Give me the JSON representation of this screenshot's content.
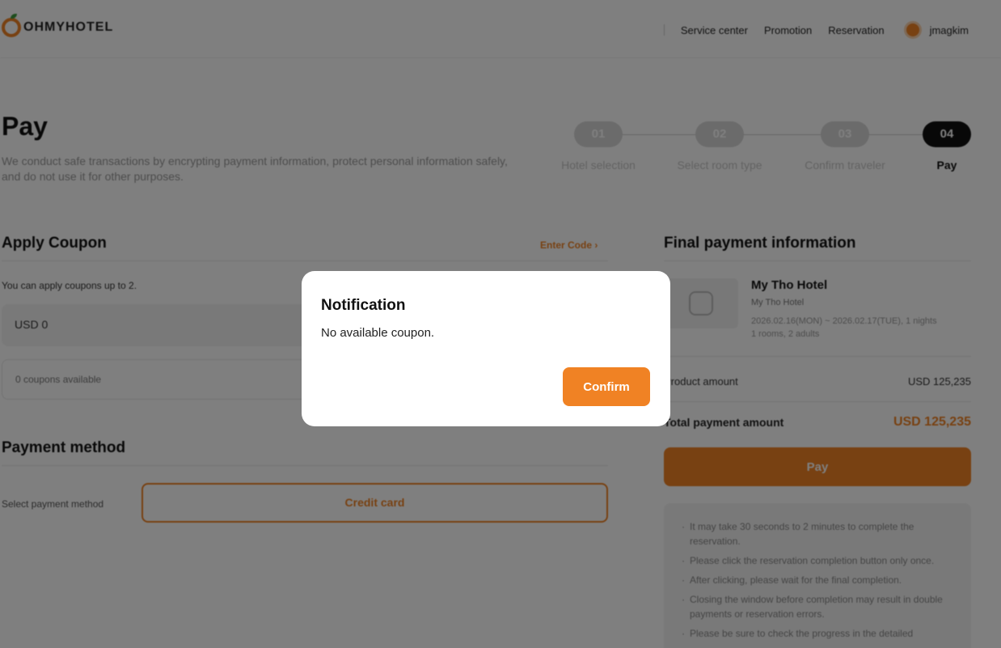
{
  "header": {
    "logo_text": "OHMYHOTEL",
    "nav": [
      "Service center",
      "Promotion",
      "Reservation"
    ],
    "username": "jmagkim"
  },
  "page": {
    "title": "Pay",
    "description": "We conduct safe transactions by encrypting payment information, protect personal information safely, and do not use it for other purposes."
  },
  "steps": [
    {
      "num": "01",
      "label": "Hotel selection",
      "active": false
    },
    {
      "num": "02",
      "label": "Select room type",
      "active": false
    },
    {
      "num": "03",
      "label": "Confirm traveler",
      "active": false
    },
    {
      "num": "04",
      "label": "Pay",
      "active": true
    }
  ],
  "coupon": {
    "title": "Apply Coupon",
    "enter_code": "Enter Code",
    "note": "You can apply coupons up to 2.",
    "amount": "USD 0",
    "available": "0 coupons available"
  },
  "payment_method": {
    "title": "Payment method",
    "label": "Select payment method",
    "option": "Credit card"
  },
  "final_payment": {
    "title": "Final payment information",
    "hotel_name": "My Tho Hotel",
    "hotel_sub": "My Tho Hotel",
    "dates": "2026.02.16(MON) ~ 2026.02.17(TUE), 1 nights",
    "guests": "1 rooms, 2 adults",
    "product_label": "Product amount",
    "product_value": "USD 125,235",
    "total_label": "Total payment amount",
    "total_value": "USD 125,235",
    "pay_button": "Pay",
    "notices": [
      "It may take 30 seconds to 2 minutes to complete the reservation.",
      "Please click the reservation completion button only once.",
      "After clicking, please wait for the final completion.",
      "Closing the window before completion may result in double payments or reservation errors.",
      "Please be sure to check the progress in the detailed"
    ]
  },
  "modal": {
    "title": "Notification",
    "message": "No available coupon.",
    "confirm": "Confirm"
  },
  "colors": {
    "accent": "#f08224",
    "overlay": "rgba(0,0,0,0.5)"
  }
}
